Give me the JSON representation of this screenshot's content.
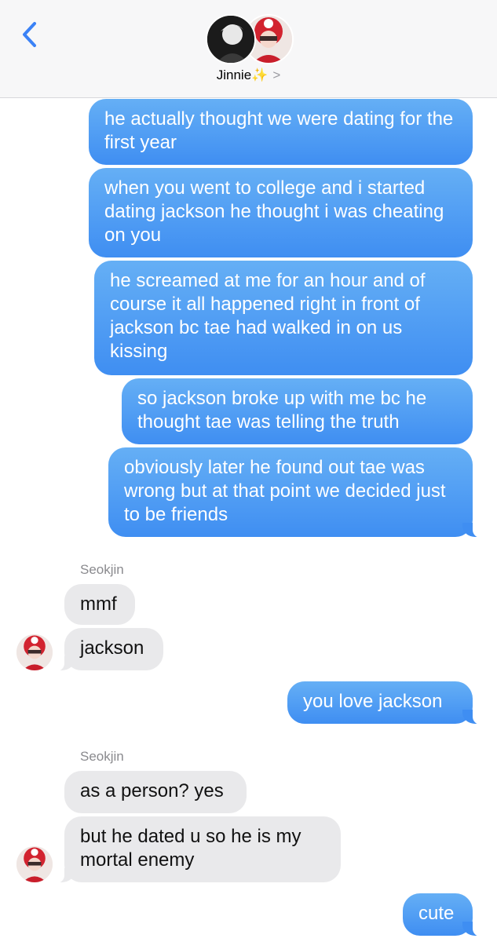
{
  "header": {
    "contact_name": "Jinnie",
    "sparkle": "✨",
    "chevron": ">"
  },
  "messages": [
    {
      "from": "me",
      "text": "he actually thought we were dating for the first year"
    },
    {
      "from": "me",
      "text": "when you went to college and i started dating jackson he thought i was cheating on you"
    },
    {
      "from": "me",
      "text": "he screamed at me for an hour and of course it all happened right in front of jackson bc tae had walked in on us kissing"
    },
    {
      "from": "me",
      "text": "so jackson broke up with me bc he thought tae was telling the truth"
    },
    {
      "from": "me",
      "text": "obviously later he found out tae was wrong but at that point we decided just to be friends"
    },
    {
      "from": "Seokjin",
      "text": "mmf"
    },
    {
      "from": "Seokjin",
      "text": "jackson"
    },
    {
      "from": "me",
      "text": "you love jackson"
    },
    {
      "from": "Seokjin",
      "text": "as a person? yes"
    },
    {
      "from": "Seokjin",
      "text": "but he dated u so he is my mortal enemy"
    },
    {
      "from": "me",
      "text": "cute"
    }
  ],
  "sender_labels": [
    "Seokjin",
    "Seokjin"
  ],
  "colors": {
    "sent_bubble": "#3f8ef2",
    "received_bubble": "#e9e9eb",
    "back_chevron": "#3b82f6"
  },
  "icons": {
    "back": "chevron-left-icon",
    "contact_avatar_1": "person-photo",
    "contact_avatar_2": "person-photo-red-hat"
  }
}
